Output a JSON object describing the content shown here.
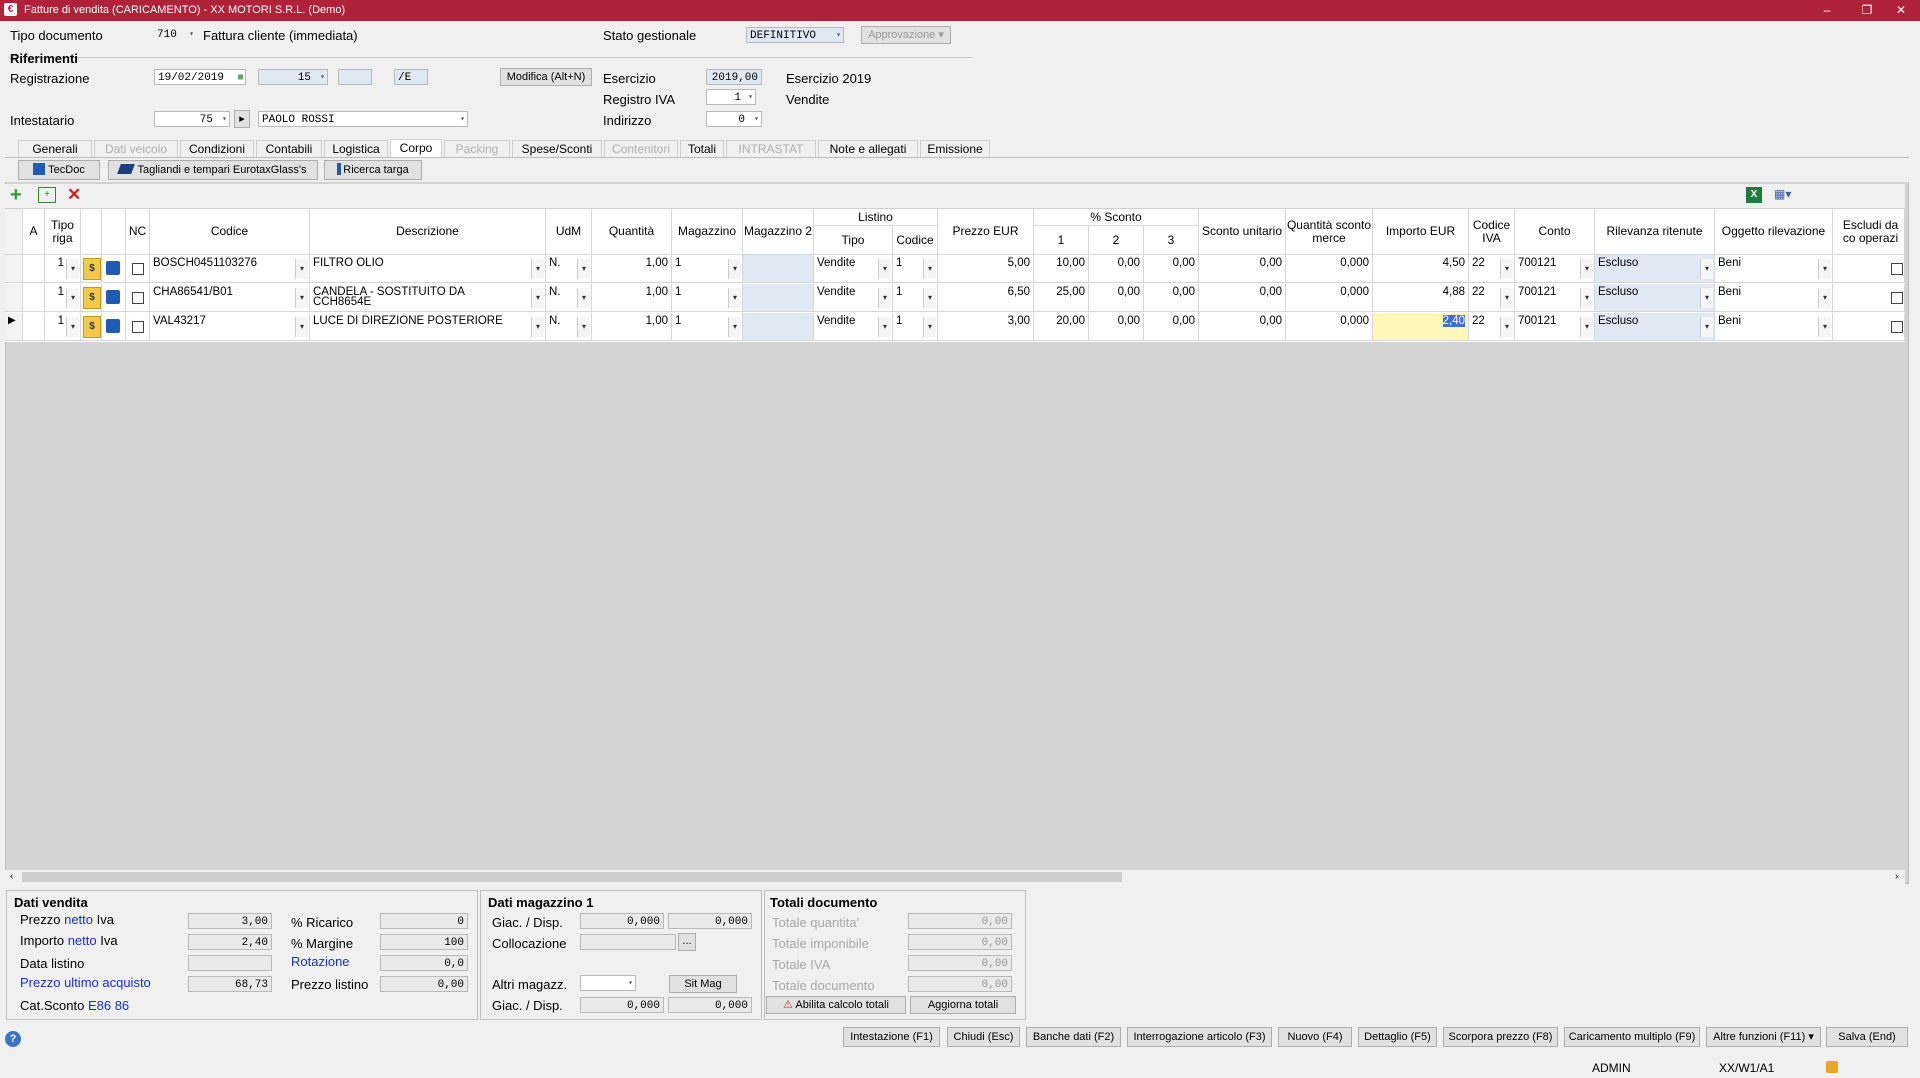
{
  "window": {
    "title": "Fatture di vendita (CARICAMENTO)  - XX  MOTORI S.R.L.  (Demo)",
    "minimize": "–",
    "restore": "❐",
    "close": "✕"
  },
  "header": {
    "tipo_documento_label": "Tipo documento",
    "tipo_documento_code": "710",
    "tipo_documento_desc": "Fattura cliente (immediata)",
    "stato_label": "Stato gestionale",
    "stato_value": "DEFINITIVO",
    "approvazione_label": "Approvazione",
    "riferimenti_label": "Riferimenti",
    "registrazione_label": "Registrazione",
    "registrazione_date": "19/02/2019",
    "registrazione_num": "15",
    "registrazione_blank": "",
    "registrazione_suffix": "/E",
    "modifica_button": "Modifica (Alt+N)",
    "esercizio_label": "Esercizio",
    "esercizio_value": "2019,00",
    "esercizio_text": "Esercizio 2019",
    "registro_iva_label": "Registro IVA",
    "registro_iva_value": "1",
    "registro_iva_text": "Vendite",
    "intestatario_label": "Intestatario",
    "intestatario_code": "75",
    "intestatario_name": "PAOLO ROSSI",
    "indirizzo_label": "Indirizzo",
    "indirizzo_value": "0"
  },
  "tabs": [
    {
      "label": "Generali",
      "state": "normal"
    },
    {
      "label": "Dati veicolo",
      "state": "disabled"
    },
    {
      "label": "Condizioni",
      "state": "normal"
    },
    {
      "label": "Contabili",
      "state": "normal"
    },
    {
      "label": "Logistica",
      "state": "normal"
    },
    {
      "label": "Corpo",
      "state": "active"
    },
    {
      "label": "Packing",
      "state": "disabled"
    },
    {
      "label": "Spese/Sconti",
      "state": "normal"
    },
    {
      "label": "Contenitori",
      "state": "disabled"
    },
    {
      "label": "Totali",
      "state": "normal"
    },
    {
      "label": "INTRASTAT",
      "state": "disabled"
    },
    {
      "label": "Note e allegati",
      "state": "normal"
    },
    {
      "label": "Emissione",
      "state": "normal"
    }
  ],
  "toolbar": {
    "tecdoc": "TecDoc",
    "tagliandi": "Tagliandi e tempari EurotaxGlass's",
    "ricerca_targa": "Ricerca targa"
  },
  "grid": {
    "headers": {
      "a": "A",
      "tipo_riga": "Tipo riga",
      "nc": "NC",
      "codice": "Codice",
      "descrizione": "Descrizione",
      "udm": "UdM",
      "quantita": "Quantità",
      "magazzino": "Magazzino",
      "magazzino2": "Magazzino 2",
      "listino": "Listino",
      "listino_tipo": "Tipo",
      "listino_codice": "Codice",
      "prezzo": "Prezzo EUR",
      "sconto_group": "% Sconto",
      "sconto1": "1",
      "sconto2": "2",
      "sconto3": "3",
      "sconto_unitario": "Sconto unitario",
      "qta_sconto_merce": "Quantità sconto merce",
      "importo": "Importo EUR",
      "codice_iva": "Codice IVA",
      "conto": "Conto",
      "rilevanza": "Rilevanza ritenute",
      "oggetto": "Oggetto rilevazione",
      "escludi": "Escludi da co operazi"
    },
    "rows": [
      {
        "tipo": "1",
        "codice": "BOSCH0451103276",
        "descrizione": "FILTRO OLIO",
        "descrizione2": "",
        "udm": "N.",
        "quantita": "1,00",
        "magazzino": "1",
        "list_tipo": "Vendite",
        "list_codice": "1",
        "prezzo": "5,00",
        "s1": "10,00",
        "s2": "0,00",
        "s3": "0,00",
        "sconto_unit": "0,00",
        "qta_sm": "0,000",
        "importo": "4,50",
        "iva": "22",
        "conto": "700121",
        "rilevanza": "Escluso",
        "oggetto": "Beni"
      },
      {
        "tipo": "1",
        "codice": "CHA86541/B01",
        "descrizione": "CANDELA - SOSTITUITO DA",
        "descrizione2": "CCH8654E",
        "udm": "N.",
        "quantita": "1,00",
        "magazzino": "1",
        "list_tipo": "Vendite",
        "list_codice": "1",
        "prezzo": "6,50",
        "s1": "25,00",
        "s2": "0,00",
        "s3": "0,00",
        "sconto_unit": "0,00",
        "qta_sm": "0,000",
        "importo": "4,88",
        "iva": "22",
        "conto": "700121",
        "rilevanza": "Escluso",
        "oggetto": "Beni"
      },
      {
        "tipo": "1",
        "codice": "VAL43217",
        "descrizione": "LUCE DI DIREZIONE POSTERIORE",
        "descrizione2": "",
        "udm": "N.",
        "quantita": "1,00",
        "magazzino": "1",
        "list_tipo": "Vendite",
        "list_codice": "1",
        "prezzo": "3,00",
        "s1": "20,00",
        "s2": "0,00",
        "s3": "0,00",
        "sconto_unit": "0,00",
        "qta_sm": "0,000",
        "importo": "2,40",
        "iva": "22",
        "conto": "700121",
        "rilevanza": "Escluso",
        "oggetto": "Beni"
      }
    ]
  },
  "dati_vendita": {
    "title": "Dati vendita",
    "prezzo_netto_label_a": "Prezzo",
    "prezzo_netto_label_b": "netto",
    "prezzo_netto_label_c": "Iva",
    "prezzo_netto": "3,00",
    "importo_netto_label_a": "Importo",
    "importo_netto_label_b": "netto",
    "importo_netto_label_c": "Iva",
    "importo_netto": "2,40",
    "data_listino_label": "Data listino",
    "data_listino": "",
    "prezzo_ultimo_label": "Prezzo ultimo acquisto",
    "prezzo_ultimo": "68,73",
    "cat_sconto_label": "Cat.Sconto",
    "cat_sconto": "E86 86",
    "ricarico_label": "% Ricarico",
    "ricarico": "0",
    "margine_label": "% Margine",
    "margine": "100",
    "rotazione_label": "Rotazione",
    "rotazione": "0,0",
    "prezzo_listino_label": "Prezzo listino",
    "prezzo_listino": "0,00"
  },
  "dati_magazzino": {
    "title": "Dati magazzino 1",
    "giac_label": "Giac. / Disp.",
    "giac1": "0,000",
    "giac2": "0,000",
    "collocazione_label": "Collocazione",
    "collocazione": "",
    "collocazione_btn": "...",
    "altri_label": "Altri magazz.",
    "sit_mag": "Sit Mag",
    "giac2_label": "Giac. / Disp.",
    "giac3": "0,000",
    "giac4": "0,000"
  },
  "totali": {
    "title": "Totali documento",
    "quantita_label": "Totale quantita'",
    "quantita": "0,00",
    "imponibile_label": "Totale imponibile",
    "imponibile": "0,00",
    "iva_label": "Totale IVA",
    "iva": "0,00",
    "documento_label": "Totale documento",
    "documento": "0,00",
    "abilita_btn": "Abilita calcolo totali",
    "aggiorna_btn": "Aggiorna totali"
  },
  "bottom_buttons": [
    "Intestazione (F1)",
    "Chiudi (Esc)",
    "Banche dati (F2)",
    "Interrogazione articolo (F3)",
    "Nuovo (F4)",
    "Dettaglio (F5)",
    "Scorpora prezzo (F8)",
    "Caricamento multiplo (F9)",
    "Altre funzioni (F11)",
    "Salva (End)"
  ],
  "status": {
    "user": "ADMIN",
    "path": "XX/W1/A1"
  },
  "colors": {
    "titlebar": "#b0213a",
    "accent_blue": "#1a2fc9",
    "selected_cell": "#3d6fd8"
  }
}
